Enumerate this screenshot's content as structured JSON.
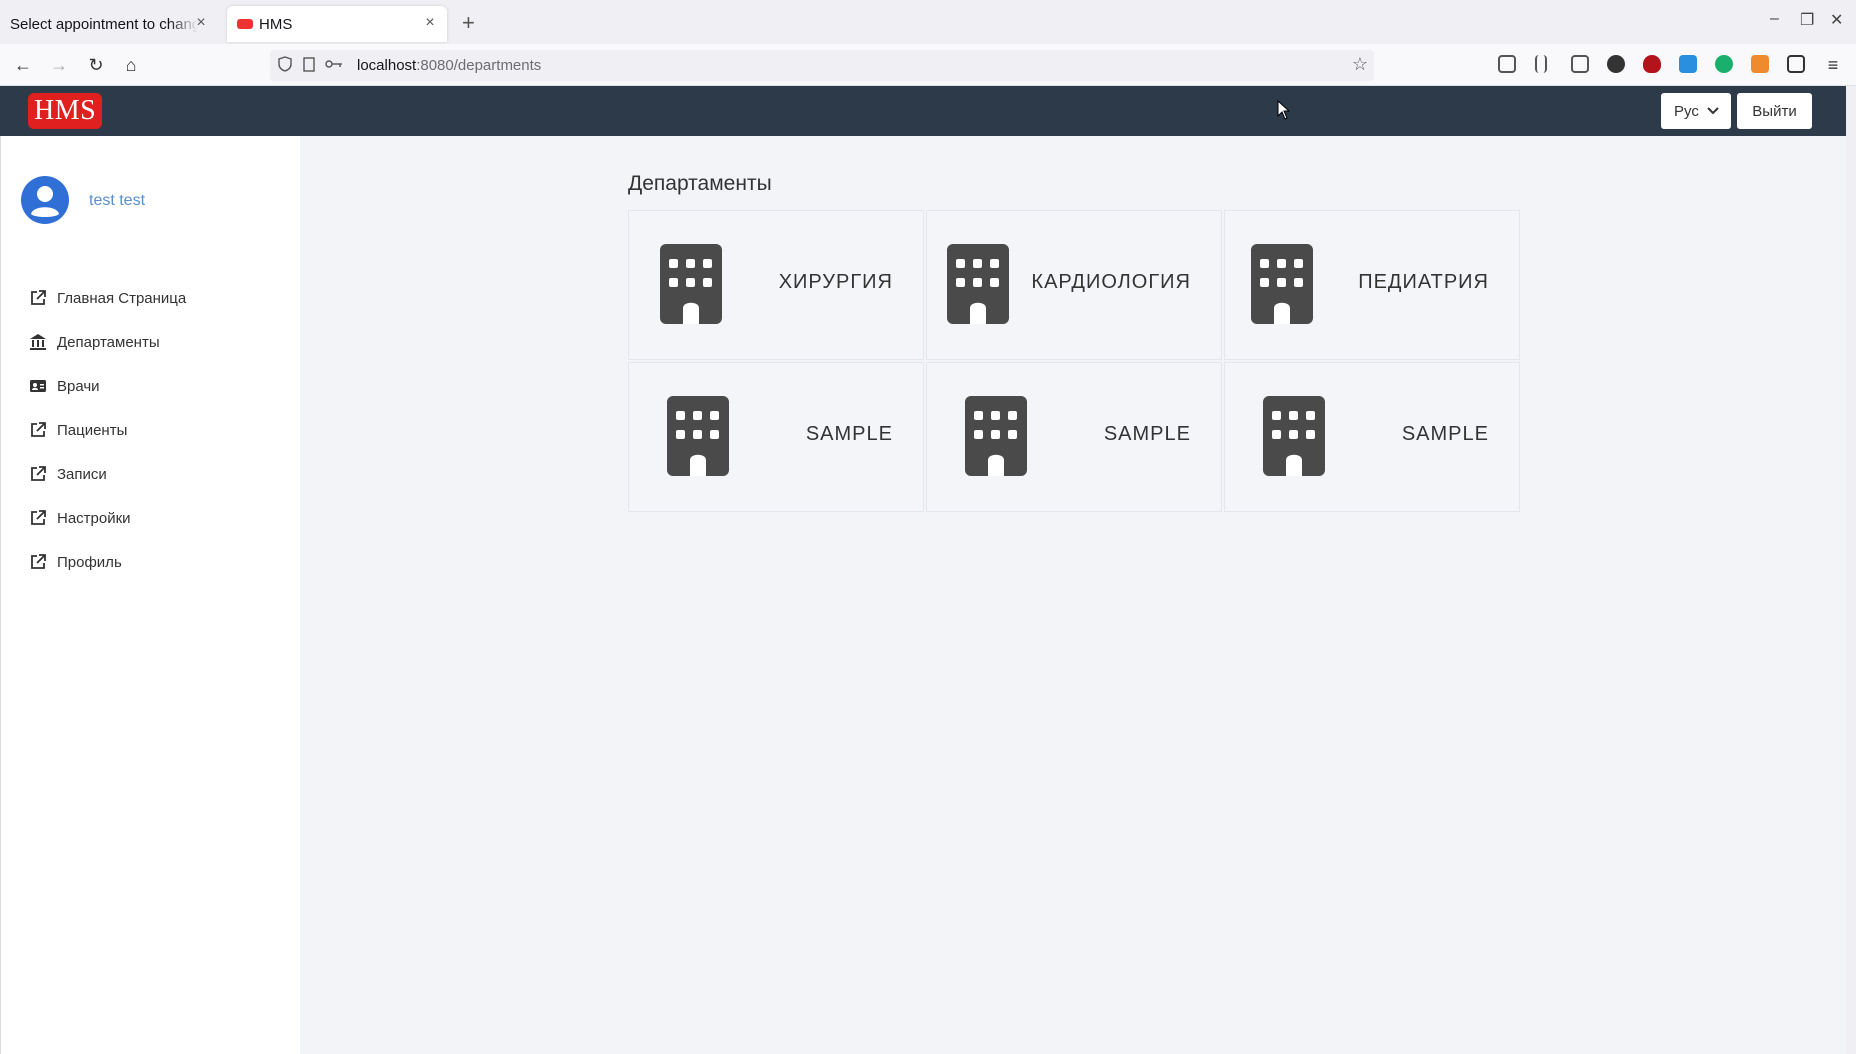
{
  "browser": {
    "tabs": [
      {
        "title": "Select appointment to change"
      },
      {
        "title": "HMS"
      }
    ],
    "url_host": "localhost",
    "url_path": ":8080/departments"
  },
  "header": {
    "logo": "HMS",
    "language": "Рус",
    "logout": "Выйти"
  },
  "sidebar": {
    "username": "test test",
    "items": [
      {
        "label": "Главная Страница",
        "icon": "external-link-icon"
      },
      {
        "label": "Департаменты",
        "icon": "bank-icon"
      },
      {
        "label": "Врачи",
        "icon": "id-card-icon"
      },
      {
        "label": "Пациенты",
        "icon": "external-link-icon"
      },
      {
        "label": "Записи",
        "icon": "external-link-icon"
      },
      {
        "label": "Настройки",
        "icon": "external-link-icon"
      },
      {
        "label": "Профиль",
        "icon": "external-link-icon"
      }
    ]
  },
  "main": {
    "title": "Департаменты",
    "departments": [
      {
        "name": "ХИРУРГИЯ"
      },
      {
        "name": "КАРДИОЛОГИЯ"
      },
      {
        "name": "ПЕДИАТРИЯ"
      },
      {
        "name": "SAMPLE"
      },
      {
        "name": "SAMPLE"
      },
      {
        "name": "SAMPLE"
      }
    ]
  },
  "colors": {
    "header_bg": "#2d3a4a",
    "logo_bg": "#e0201e",
    "username": "#5a8fd0",
    "avatar": "#2f6fd6",
    "icon": "#4a4a4a"
  }
}
